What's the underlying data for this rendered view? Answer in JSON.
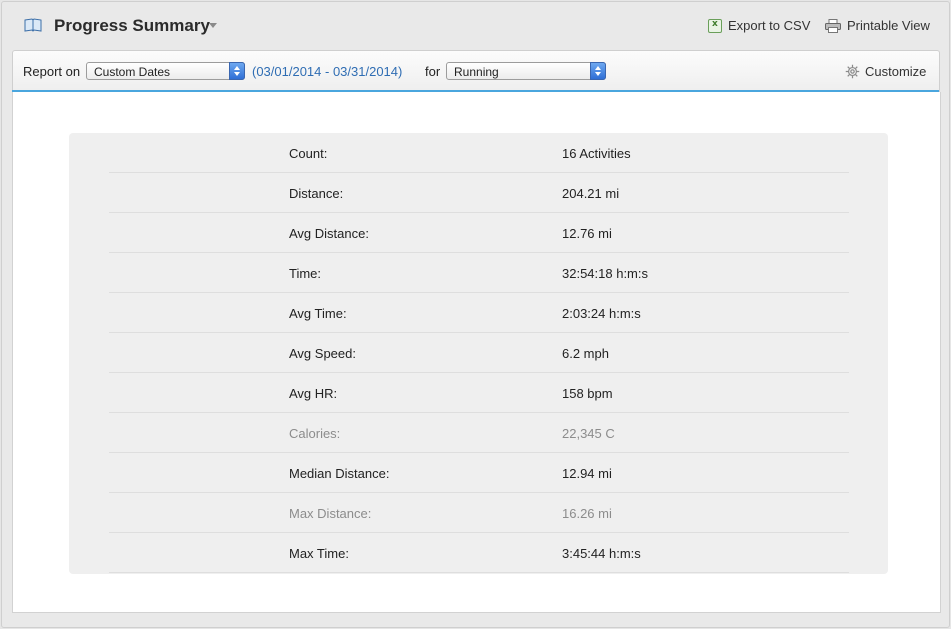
{
  "header": {
    "title": "Progress Summary",
    "export_label": "Export to CSV",
    "printable_label": "Printable View"
  },
  "toolbar": {
    "report_on_label": "Report on",
    "date_select_value": "Custom Dates",
    "date_range": "(03/01/2014 - 03/31/2014)",
    "for_label": "for",
    "sport_select_value": "Running",
    "customize_label": "Customize"
  },
  "summary": {
    "rows": [
      {
        "label": "Count:",
        "value": "16 Activities"
      },
      {
        "label": "Distance:",
        "value": "204.21 mi"
      },
      {
        "label": "Avg Distance:",
        "value": "12.76 mi"
      },
      {
        "label": "Time:",
        "value": "32:54:18 h:m:s"
      },
      {
        "label": "Avg Time:",
        "value": "2:03:24 h:m:s"
      },
      {
        "label": "Avg Speed:",
        "value": "6.2 mph"
      },
      {
        "label": "Avg HR:",
        "value": "158 bpm"
      },
      {
        "label": "Calories:",
        "value": "22,345 C"
      },
      {
        "label": "Median Distance:",
        "value": "12.94 mi"
      },
      {
        "label": "Max Distance:",
        "value": "16.26 mi"
      },
      {
        "label": "Max Time:",
        "value": "3:45:44 h:m:s"
      }
    ]
  },
  "colors": {
    "accent_line": "#4aa6de",
    "link_blue": "#2f6db3",
    "table_bg": "#efefef"
  }
}
